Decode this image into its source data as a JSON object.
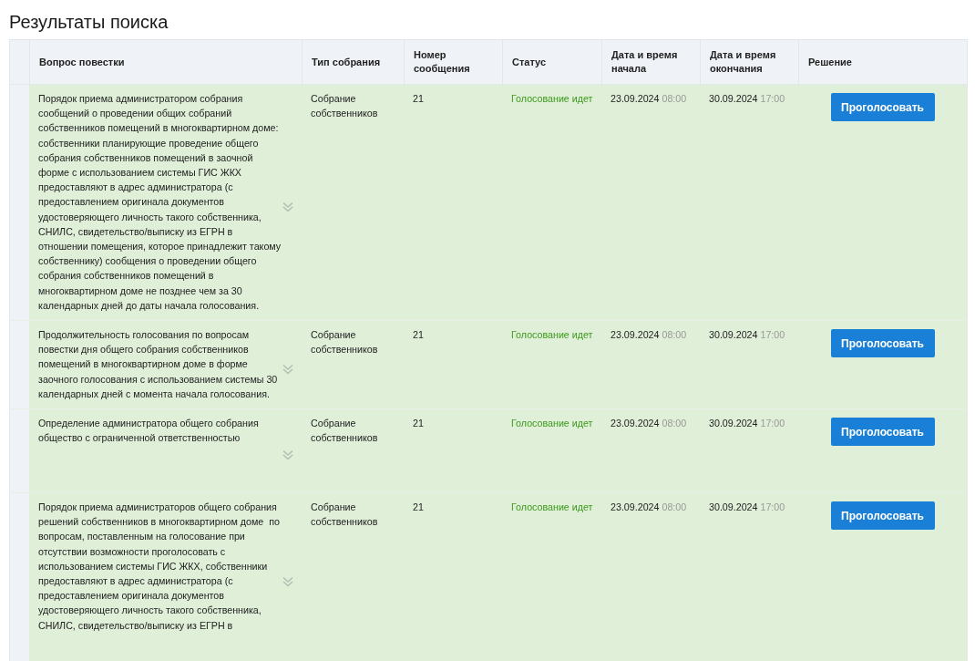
{
  "title": "Результаты поиска",
  "table": {
    "columns": [
      "Вопрос повестки",
      "Тип собрания",
      "Номер сообщения",
      "Статус",
      "Дата и время начала",
      "Дата и время окончания",
      "Решение"
    ],
    "rows": [
      {
        "question": "Порядок приема администратором собрания сообщений о проведении общих собраний собственников помещений в многоквартирном доме: собственники планирующие проведение общего собрания собственников помещений в заочной форме с использованием системы ГИС ЖКХ предоставляют в адрес администратора (с предоставлением оригинала документов удостоверяющего личность такого собственника, СНИЛС, свидетельство/выписку из ЕГРН в отношении помещения, которое принадлежит такому собственнику) сообщения о проведении общего собрания собственников помещений в многоквартирном доме не позднее чем за 30 календарных дней до даты начала голосования.",
        "meeting_type": "Собрание собственников",
        "number": "21",
        "status": "Голосование идет",
        "start": {
          "date": "23.09.2024",
          "time": "08:00"
        },
        "end": {
          "date": "30.09.2024",
          "time": "17:00"
        },
        "action": "Проголосовать"
      },
      {
        "question": "Продолжительность голосования по вопросам повестки дня общего собрания собственников помещений в многоквартирном доме в форме заочного голосования с использованием системы 30 календарных дней с момента начала голосования.",
        "meeting_type": "Собрание собственников",
        "number": "21",
        "status": "Голосование идет",
        "start": {
          "date": "23.09.2024",
          "time": "08:00"
        },
        "end": {
          "date": "30.09.2024",
          "time": "17:00"
        },
        "action": "Проголосовать"
      },
      {
        "question": "Определение администратора общего собрания общество с ограниченной ответственностью",
        "meeting_type": "Собрание собственников",
        "number": "21",
        "status": "Голосование идет",
        "start": {
          "date": "23.09.2024",
          "time": "08:00"
        },
        "end": {
          "date": "30.09.2024",
          "time": "17:00"
        },
        "action": "Проголосовать"
      },
      {
        "question": "Порядок приема администраторов общего собрания решений собственников в многоквартирном доме  по вопросам, поставленным на голосование при отсутствии возможности проголосовать с использованием системы ГИС ЖКХ, собственники предоставляют в адрес администратора (с предоставлением оригинала документов удостоверяющего личность такого собственника, СНИЛС, свидетельство/выписку из ЕГРН в",
        "meeting_type": "Собрание собственников",
        "number": "21",
        "status": "Голосование идет",
        "start": {
          "date": "23.09.2024",
          "time": "08:00"
        },
        "end": {
          "date": "30.09.2024",
          "time": "17:00"
        },
        "action": "Проголосовать"
      }
    ]
  }
}
